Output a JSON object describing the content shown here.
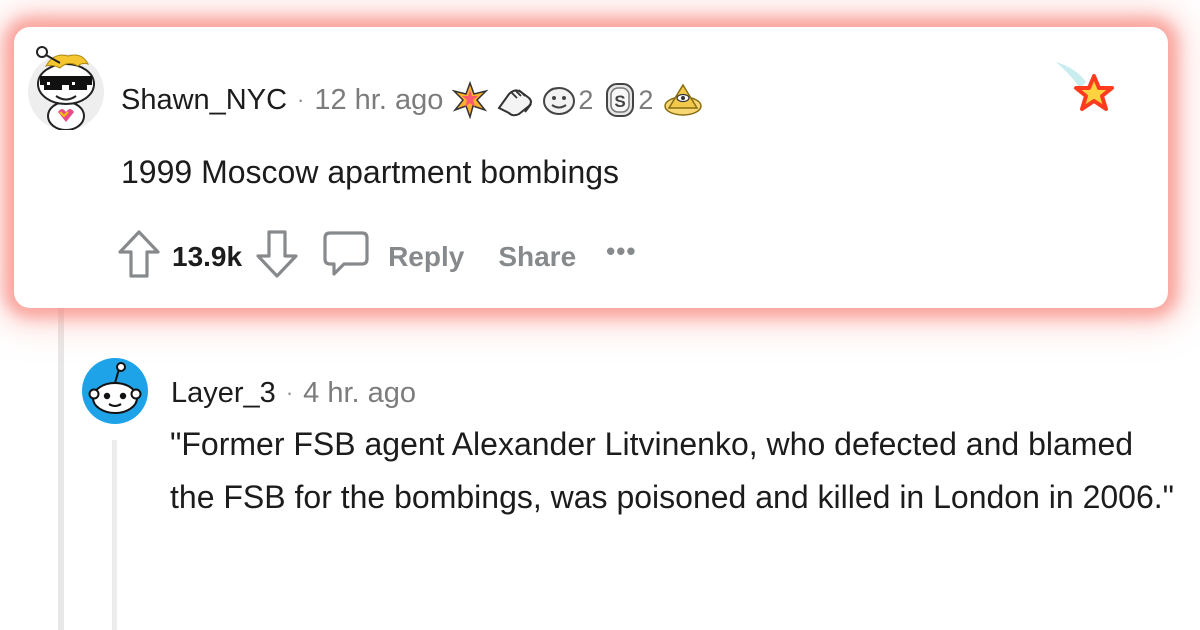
{
  "comments": [
    {
      "username": "Shawn_NYC",
      "separator": "·",
      "time": "12 hr. ago",
      "awards": [
        {
          "icon": "starburst-award-icon"
        },
        {
          "icon": "bro-fist-award-icon"
        },
        {
          "icon": "face-award-icon",
          "count": "2"
        },
        {
          "icon": "silver-s-award-icon",
          "count": "2"
        },
        {
          "icon": "illuminati-pyramid-award-icon"
        }
      ],
      "body": "1999 Moscow apartment bombings",
      "score": "13.9k",
      "reply_label": "Reply",
      "share_label": "Share",
      "more_label": "•••",
      "highlighted": true
    },
    {
      "username": "Layer_3",
      "separator": "·",
      "time": "4 hr. ago",
      "body": "\"Former FSB agent Alexander Litvinenko, who defected and blamed the FSB for the bombings, was poisoned and killed in London in 2006.\""
    }
  ],
  "colors": {
    "highlight_glow": "#f87a6e",
    "username": "#1c1c1c",
    "meta_gray": "#7c7c7c",
    "action_gray": "#878a8c",
    "avatar_blue": "#1fa3e8",
    "star_red": "#ff3b1f",
    "star_yellow": "#ffd23f"
  }
}
